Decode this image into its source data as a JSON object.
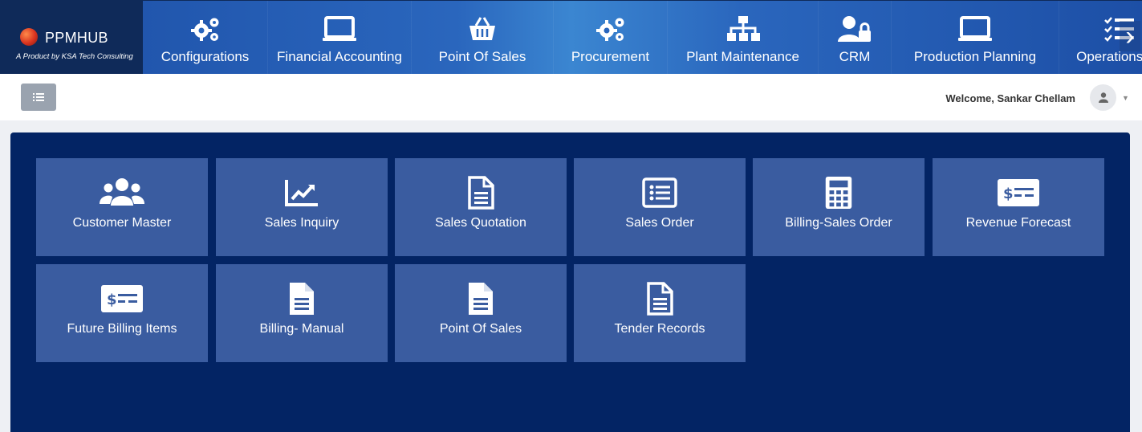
{
  "brand": {
    "name": "PPMHUB",
    "tagline": "A Product by KSA Tech Consulting"
  },
  "topnav": {
    "items": [
      {
        "label": "Configurations",
        "icon": "gears-icon"
      },
      {
        "label": "Financial Accounting",
        "icon": "laptop-icon"
      },
      {
        "label": "Point Of Sales",
        "icon": "basket-icon"
      },
      {
        "label": "Procurement",
        "icon": "gears-icon"
      },
      {
        "label": "Plant Maintenance",
        "icon": "sitemap-icon"
      },
      {
        "label": "CRM",
        "icon": "user-lock-icon"
      },
      {
        "label": "Production Planning",
        "icon": "laptop-icon"
      },
      {
        "label": "Operations Or",
        "icon": "tasks-icon"
      }
    ],
    "next_arrow": "›"
  },
  "header": {
    "welcome": "Welcome, Sankar Chellam"
  },
  "tiles": [
    {
      "label": "Customer Master",
      "icon": "users-icon"
    },
    {
      "label": "Sales Inquiry",
      "icon": "chart-line-icon"
    },
    {
      "label": "Sales Quotation",
      "icon": "file-icon"
    },
    {
      "label": "Sales Order",
      "icon": "list-alt-icon"
    },
    {
      "label": "Billing-Sales Order",
      "icon": "calculator-icon"
    },
    {
      "label": "Revenue Forecast",
      "icon": "money-check-icon"
    },
    {
      "label": "Future Billing Items",
      "icon": "money-check-icon"
    },
    {
      "label": "Billing- Manual",
      "icon": "file-solid-icon"
    },
    {
      "label": "Point Of Sales",
      "icon": "file-solid-icon"
    },
    {
      "label": "Tender Records",
      "icon": "file-icon"
    }
  ],
  "colors": {
    "brand_bg": "#0f2a59",
    "panel_bg": "#032464",
    "tile_bg": "#3a5ca0",
    "nav_bg": "#2a66bd"
  }
}
